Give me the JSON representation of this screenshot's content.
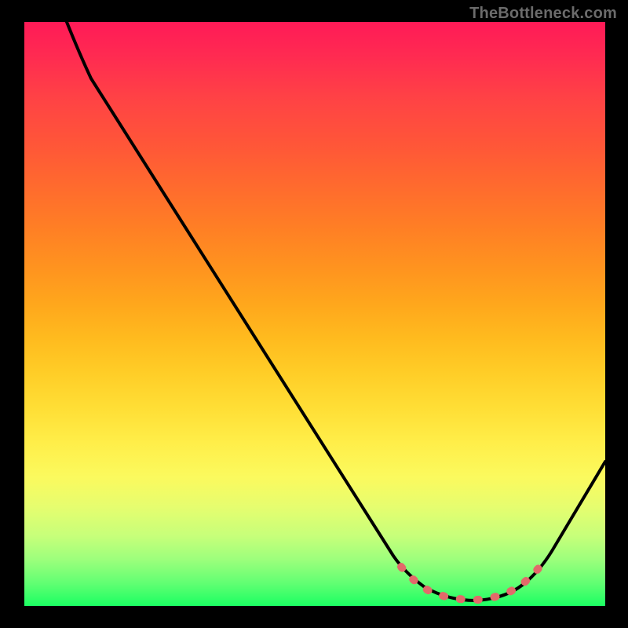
{
  "watermark": "TheBottleneck.com",
  "colors": {
    "background": "#000000",
    "watermark_text": "#6b6b6b",
    "curve": "#000000",
    "marker": "#e26a6a",
    "gradient_top": "#ff1a57",
    "gradient_bottom": "#1bff62"
  },
  "chart_data": {
    "type": "line",
    "title": "",
    "xlabel": "",
    "ylabel": "",
    "xlim": [
      0,
      100
    ],
    "ylim": [
      0,
      100
    ],
    "grid": false,
    "legend": false,
    "series": [
      {
        "name": "bottleneck_curve",
        "x": [
          7,
          12,
          20,
          30,
          40,
          50,
          60,
          64,
          68,
          72,
          76,
          80,
          84,
          88,
          92,
          100
        ],
        "y": [
          100,
          90,
          76,
          59,
          42,
          25,
          10,
          6,
          3,
          1.5,
          1,
          1.5,
          3,
          6,
          12,
          25
        ]
      }
    ],
    "annotations": [
      {
        "name": "optimal_zone",
        "x_range": [
          65,
          89
        ],
        "note": "dotted marker near curve minimum"
      }
    ],
    "background_gradient": {
      "direction": "vertical_top_to_bottom",
      "description": "bottleneck severity heatmap, red (high y) to green (low y)",
      "stops": [
        {
          "pos": 0.0,
          "color": "#ff1a57"
        },
        {
          "pos": 0.5,
          "color": "#ffba1e"
        },
        {
          "pos": 0.78,
          "color": "#fbfa5e"
        },
        {
          "pos": 1.0,
          "color": "#1bff62"
        }
      ]
    }
  }
}
